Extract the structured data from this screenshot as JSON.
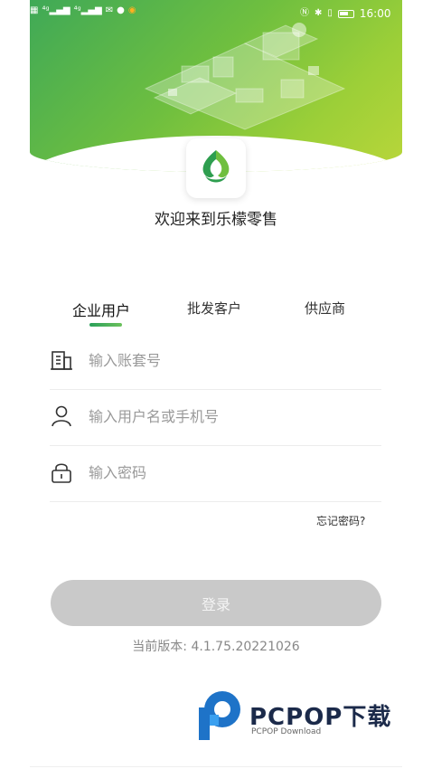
{
  "status_bar": {
    "time": "16:00",
    "left_icons": [
      "hd-icon",
      "signal-4g-icon",
      "signal-4g-icon",
      "mail-icon",
      "chat-icon",
      "app-badge-icon"
    ],
    "right_icons": [
      "nfc-icon",
      "bluetooth-icon",
      "vibrate-icon",
      "battery-icon"
    ]
  },
  "header": {
    "welcome": "欢迎来到乐檬零售"
  },
  "tabs": [
    {
      "label": "企业用户",
      "active": true
    },
    {
      "label": "批发客户",
      "active": false
    },
    {
      "label": "供应商",
      "active": false
    }
  ],
  "form": {
    "account": {
      "placeholder": "输入账套号",
      "icon": "building-icon"
    },
    "username": {
      "placeholder": "输入用户名或手机号",
      "icon": "user-icon"
    },
    "password": {
      "placeholder": "输入密码",
      "icon": "lock-icon"
    },
    "forgot_label": "忘记密码?",
    "login_label": "登录"
  },
  "version": "当前版本: 4.1.75.20221026",
  "watermark": {
    "title": "PCPOP下载",
    "subtitle": "PCPOP Download"
  },
  "colors": {
    "brand_green": "#3fa957",
    "button_disabled": "#c9c9c9"
  }
}
